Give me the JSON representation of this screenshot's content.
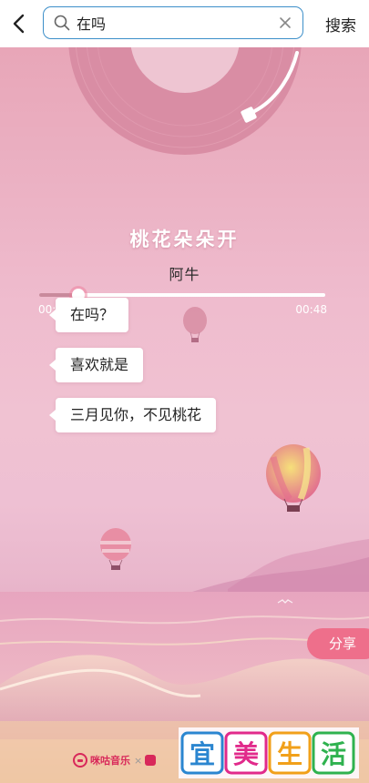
{
  "search": {
    "query": "在吗",
    "button_label": "搜索"
  },
  "player": {
    "song_title": "桃花朵朵开",
    "artist": "阿牛",
    "current_time": "00:05",
    "total_time": "00:48",
    "progress": 0.137
  },
  "lyrics": [
    {
      "text": "在吗？"
    },
    {
      "text": "喜欢就是"
    },
    {
      "text": "三月见你，不见桃花"
    }
  ],
  "share": {
    "label": "分享"
  },
  "footer": {
    "brand": "咪咕音乐"
  },
  "watermark": {
    "chars": [
      "宜",
      "美",
      "生",
      "活"
    ],
    "colors": [
      "#2b86d0",
      "#e12a8b",
      "#f1a01a",
      "#2fb24f"
    ]
  },
  "colors": {
    "accent": "#3d8fc9",
    "share": "#ee6f8b"
  }
}
